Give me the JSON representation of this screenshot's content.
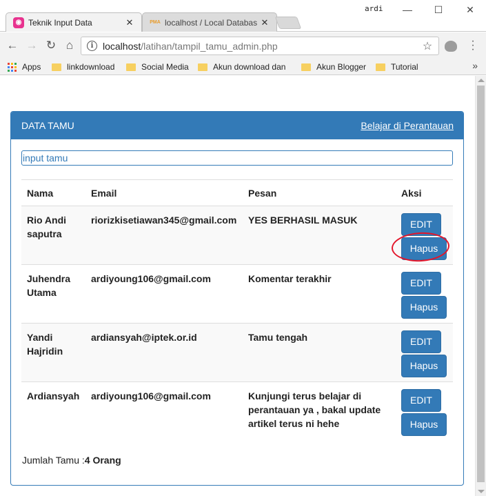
{
  "browser": {
    "tabs": [
      {
        "title": "Teknik Input Data",
        "active": true
      },
      {
        "title": "localhost / Local Databas",
        "active": false
      }
    ],
    "window_user": "ardi",
    "url_host": "localhost",
    "url_path": "/latihan/tampil_tamu_admin.php",
    "bookmarks": [
      {
        "label": "Apps",
        "icon": "apps-grid-icon"
      },
      {
        "label": "linkdownload",
        "icon": "folder-icon"
      },
      {
        "label": "Social Media",
        "icon": "folder-icon"
      },
      {
        "label": "Akun download dan",
        "icon": "folder-icon"
      },
      {
        "label": "Akun Blogger",
        "icon": "folder-icon"
      },
      {
        "label": "Tutorial",
        "icon": "folder-icon"
      }
    ],
    "bookmarks_more": "»"
  },
  "panel": {
    "title": "DATA TAMU",
    "header_link": "Belajar di Perantauan",
    "search_placeholder": "input tamu"
  },
  "table": {
    "headers": {
      "nama": "Nama",
      "email": "Email",
      "pesan": "Pesan",
      "aksi": "Aksi"
    },
    "edit_label": "EDIT",
    "hapus_label": "Hapus",
    "rows": [
      {
        "nama": "Rio Andi saputra",
        "email": "riorizkisetiawan345@gmail.com",
        "pesan": "YES BERHASIL MASUK"
      },
      {
        "nama": "Juhendra Utama",
        "email": "ardiyoung106@gmail.com",
        "pesan": "Komentar terakhir"
      },
      {
        "nama": "Yandi Hajridin",
        "email": "ardiansyah@iptek.or.id",
        "pesan": "Tamu tengah"
      },
      {
        "nama": "Ardiansyah",
        "email": "ardiyoung106@gmail.com",
        "pesan": "Kunjungi terus belajar di perantauan ya , bakal update artikel terus ni hehe"
      }
    ]
  },
  "footer": {
    "label": "Jumlah Tamu :",
    "count": "4 Orang"
  },
  "colors": {
    "primary": "#337ab7",
    "annotation": "#e3152a"
  }
}
